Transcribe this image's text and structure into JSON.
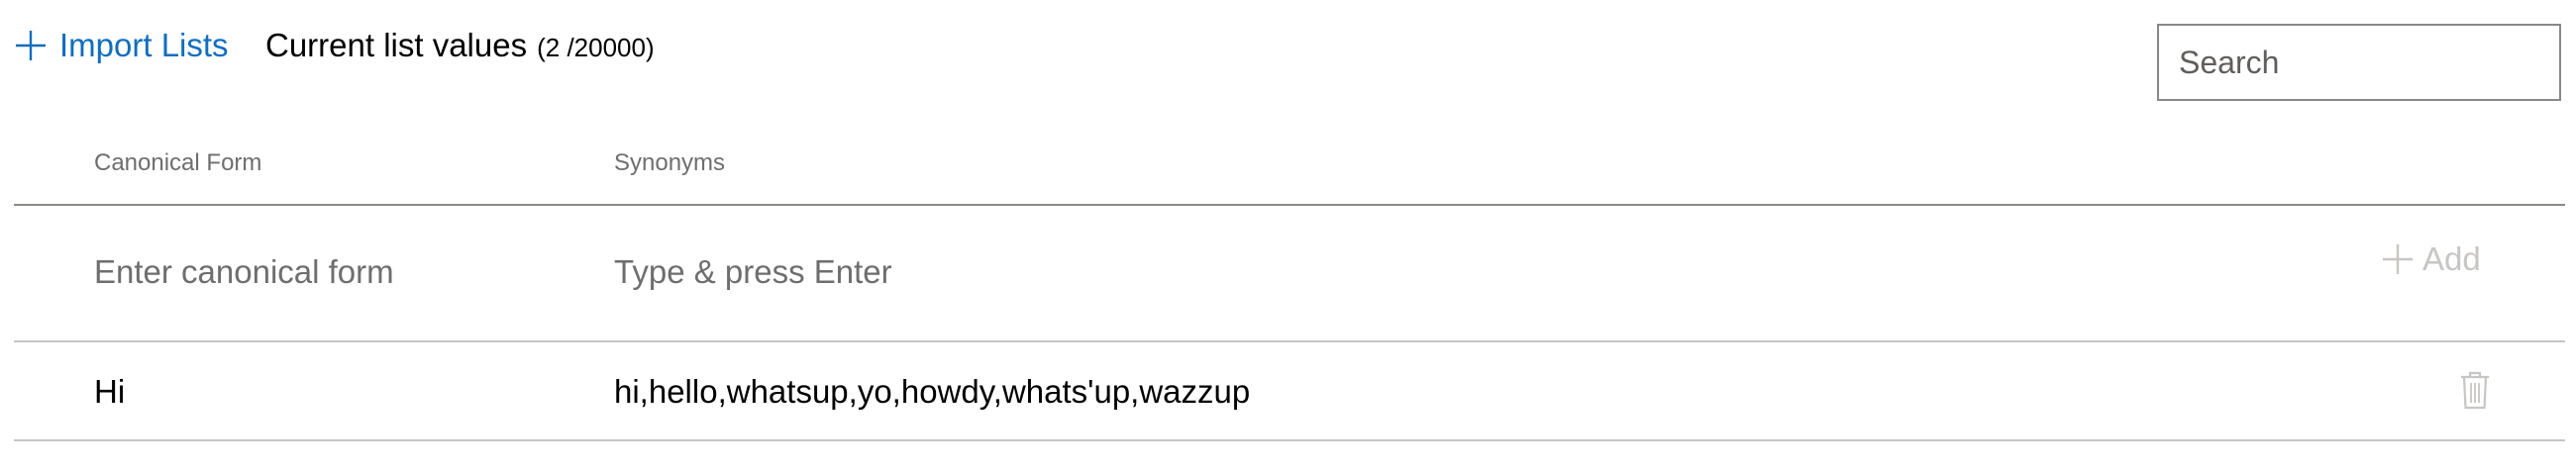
{
  "toolbar": {
    "import_label": "Import Lists",
    "title": "Current list values",
    "count": "(2 /20000)",
    "search_placeholder": "Search"
  },
  "table": {
    "columns": [
      "Canonical Form",
      "Synonyms"
    ],
    "new_row": {
      "canonical_placeholder": "Enter canonical form",
      "synonyms_placeholder": "Type & press Enter",
      "add_label": "Add"
    },
    "rows": [
      {
        "canonical": "Hi",
        "synonyms": "hi,hello,whatsup,yo,howdy,whats'up,wazzup"
      }
    ]
  },
  "colors": {
    "accent": "#106ebe",
    "disabled": "#c8c6c4",
    "muted_text": "#6e6e6e"
  },
  "icons": {
    "import": "plus-icon",
    "add": "plus-icon",
    "delete": "trash-icon"
  }
}
